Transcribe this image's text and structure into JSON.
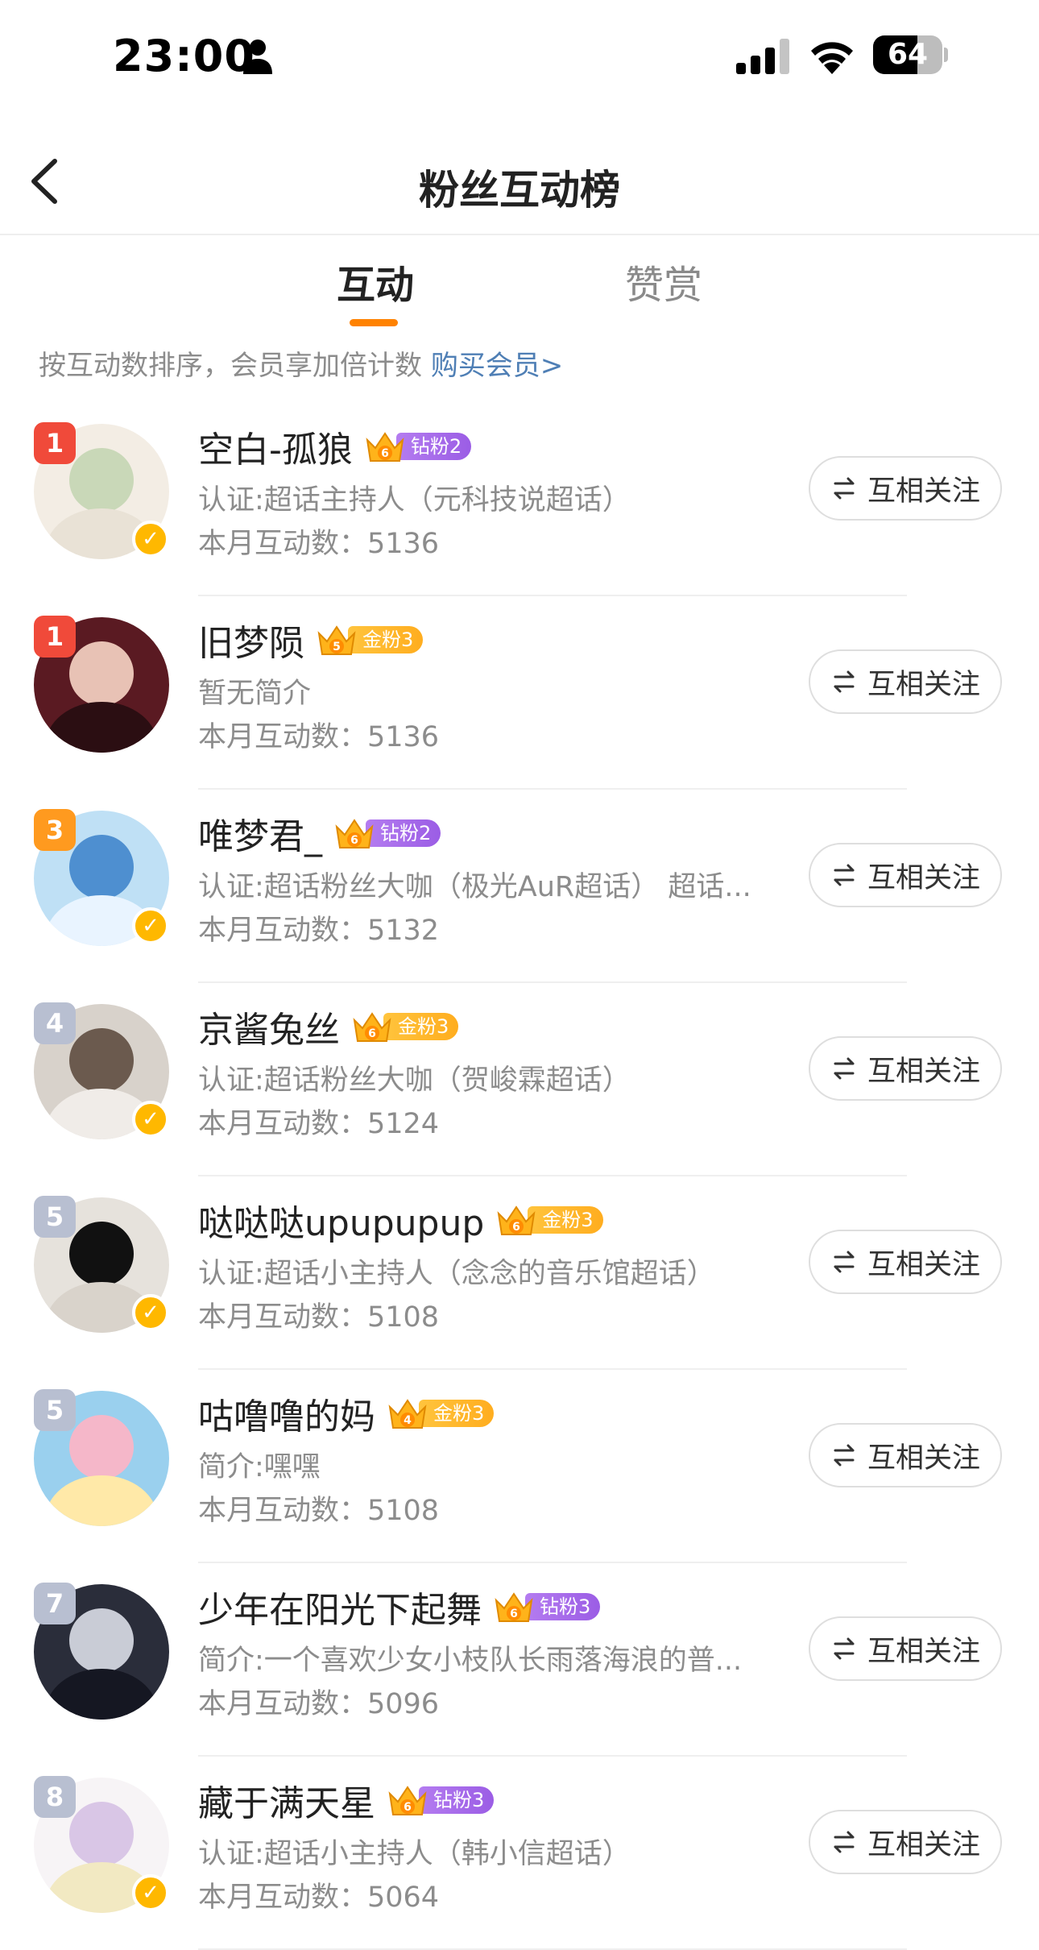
{
  "status_bar": {
    "time": "23:00",
    "battery": "64",
    "battery_level": 0.64
  },
  "nav": {
    "title": "粉丝互动榜"
  },
  "tabs": [
    {
      "label": "互动",
      "active": true
    },
    {
      "label": "赞赏",
      "active": false
    }
  ],
  "hint": {
    "text": "按互动数排序，会员享加倍计数 ",
    "link": "购买会员>"
  },
  "colors": {
    "accent": "#ff8200",
    "link": "#4f7fb5",
    "rank_red": "#f04a3a",
    "rank_orange": "#ff9a1f",
    "rank_gray": "#b8bfd1",
    "verified": "#ffb800"
  },
  "users": [
    {
      "rank": "1",
      "rank_color": "#f04a3a",
      "name": "空白-孤狼",
      "crown_level": "6",
      "badge": "钻粉2",
      "badge_type": "purple",
      "desc": "认证:超话主持人（元科技说超话）",
      "count": "本月互动数：5136",
      "verified": true,
      "follow": "互相关注",
      "avatar_colors": [
        "#f3ede4",
        "#c9d8b8",
        "#e9e2d6"
      ]
    },
    {
      "rank": "1",
      "rank_color": "#f04a3a",
      "name": "旧梦陨",
      "crown_level": "5",
      "badge": "金粉3",
      "badge_type": "gold",
      "desc": "暂无简介",
      "count": "本月互动数：5136",
      "verified": false,
      "follow": "互相关注",
      "avatar_colors": [
        "#5a1a22",
        "#e8c2b5",
        "#2b0e12"
      ]
    },
    {
      "rank": "3",
      "rank_color": "#ff9a1f",
      "name": "唯梦君_",
      "crown_level": "6",
      "badge": "钻粉2",
      "badge_type": "purple",
      "desc": "认证:超话粉丝大咖（极光AuR超话） 超话...",
      "count": "本月互动数：5132",
      "verified": true,
      "follow": "互相关注",
      "avatar_colors": [
        "#bfe0f5",
        "#4e8fd0",
        "#e9f4ff"
      ]
    },
    {
      "rank": "4",
      "rank_color": "#b8bfd1",
      "name": "京酱兔丝",
      "crown_level": "6",
      "badge": "金粉3",
      "badge_type": "gold",
      "desc": "认证:超话粉丝大咖（贺峻霖超话）",
      "count": "本月互动数：5124",
      "verified": true,
      "follow": "互相关注",
      "avatar_colors": [
        "#d8d2cb",
        "#6b5a4e",
        "#f0ece8"
      ]
    },
    {
      "rank": "5",
      "rank_color": "#b8bfd1",
      "name": "哒哒哒upupupup",
      "crown_level": "6",
      "badge": "金粉3",
      "badge_type": "gold",
      "desc": "认证:超话小主持人（念念的音乐馆超话）",
      "count": "本月互动数：5108",
      "verified": true,
      "follow": "互相关注",
      "avatar_colors": [
        "#e6e2dc",
        "#111111",
        "#d9d3cb"
      ]
    },
    {
      "rank": "5",
      "rank_color": "#b8bfd1",
      "name": "咕噜噜的妈",
      "crown_level": "4",
      "badge": "金粉3",
      "badge_type": "gold",
      "desc": "简介:嘿嘿",
      "count": "本月互动数：5108",
      "verified": false,
      "follow": "互相关注",
      "avatar_colors": [
        "#9ad0ee",
        "#f5b7c9",
        "#ffe9a8"
      ]
    },
    {
      "rank": "7",
      "rank_color": "#b8bfd1",
      "name": "少年在阳光下起舞",
      "crown_level": "6",
      "badge": "钻粉3",
      "badge_type": "purple",
      "desc": "简介:一个喜欢少女小枝队长雨落海浪的普...",
      "count": "本月互动数：5096",
      "verified": false,
      "follow": "互相关注",
      "avatar_colors": [
        "#2a2d3a",
        "#c9ccd6",
        "#151722"
      ]
    },
    {
      "rank": "8",
      "rank_color": "#b8bfd1",
      "name": "藏于满天星",
      "crown_level": "6",
      "badge": "钻粉3",
      "badge_type": "purple",
      "desc": "认证:超话小主持人（韩小信超话）",
      "count": "本月互动数：5064",
      "verified": true,
      "follow": "互相关注",
      "avatar_colors": [
        "#f7f4f6",
        "#d9c6e6",
        "#f2e9c2"
      ]
    }
  ]
}
